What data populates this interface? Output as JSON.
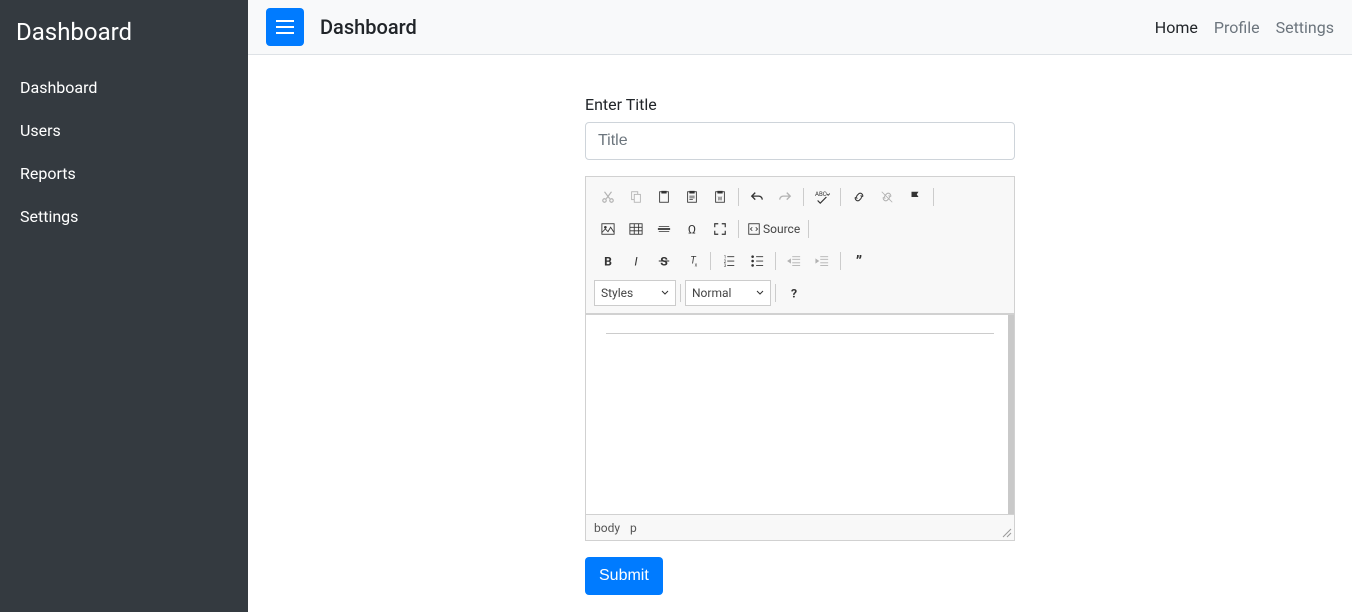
{
  "sidebar": {
    "title": "Dashboard",
    "items": [
      "Dashboard",
      "Users",
      "Reports",
      "Settings"
    ]
  },
  "topbar": {
    "page_title": "Dashboard",
    "nav": {
      "home": "Home",
      "profile": "Profile",
      "settings": "Settings"
    }
  },
  "form": {
    "label": "Enter Title",
    "placeholder": "Title",
    "submit": "Submit"
  },
  "editor": {
    "toolbar": {
      "row1": {
        "cut": "Cut",
        "copy": "Copy",
        "paste": "Paste",
        "paste_text": "Paste as plain text",
        "paste_word": "Paste from Word",
        "undo": "Undo",
        "redo": "Redo",
        "spellcheck": "Spell Checker",
        "link": "Link",
        "unlink": "Unlink",
        "anchor": "Anchor"
      },
      "row2": {
        "image": "Image",
        "table": "Table",
        "hr": "Horizontal Line",
        "specialchar": "Special Character",
        "maximize": "Maximize",
        "source": "Source"
      },
      "row3": {
        "bold": "Bold",
        "italic": "Italic",
        "strike": "Strikethrough",
        "removeformat": "Remove Format",
        "numbered": "Numbered List",
        "bulleted": "Bulleted List",
        "outdent": "Outdent",
        "indent": "Indent",
        "blockquote": "Block Quote"
      },
      "row4": {
        "styles": "Styles",
        "format": "Normal",
        "about": "About"
      }
    },
    "status": {
      "body": "body",
      "p": "p"
    }
  }
}
